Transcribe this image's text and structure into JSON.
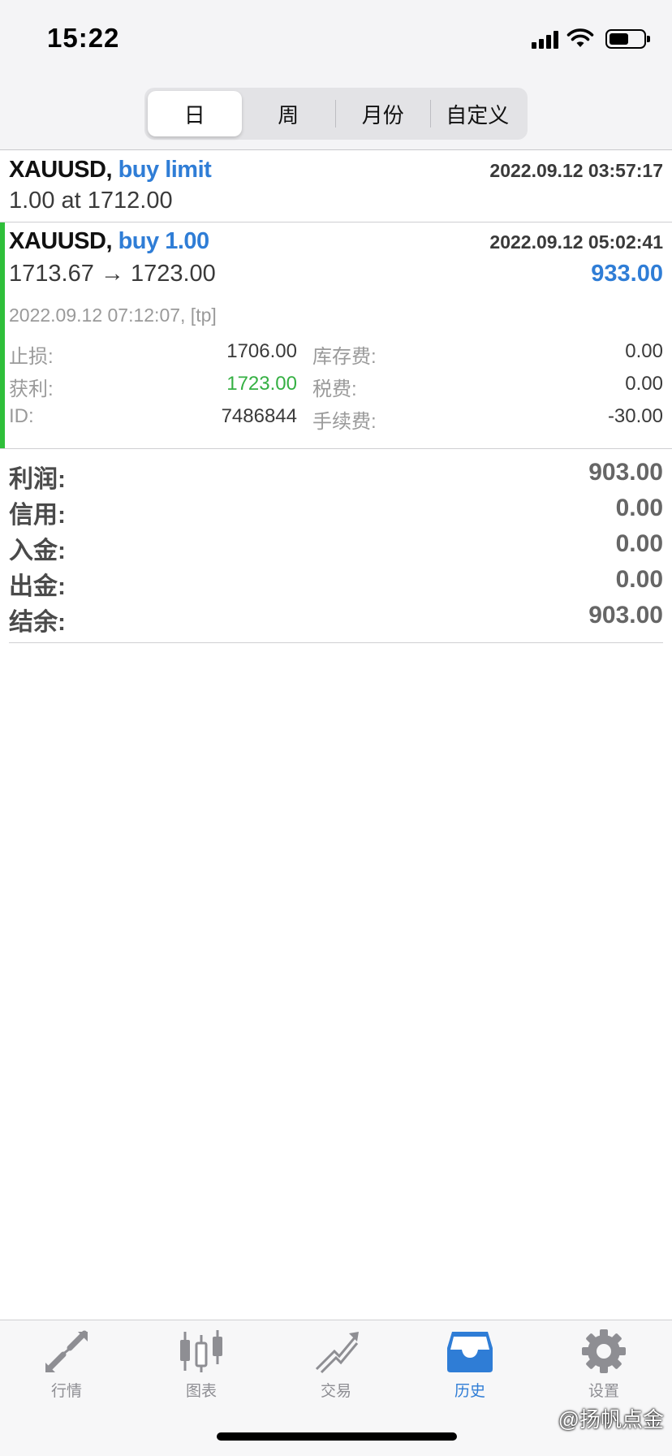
{
  "status_bar": {
    "time": "15:22",
    "battery_level": 0.6
  },
  "period_tabs": {
    "items": [
      "日",
      "周",
      "月份",
      "自定义"
    ],
    "active": "日"
  },
  "order": {
    "symbol": "XAUUSD,",
    "action": "buy limit",
    "time": "2022.09.12 03:57:17",
    "price_line": "1.00 at 1712.00"
  },
  "deal": {
    "symbol": "XAUUSD,",
    "action": "buy 1.00",
    "time": "2022.09.12 05:02:41",
    "price_line": "1713.67 → 1723.00",
    "profit": "933.00",
    "close_info": "2022.09.12 07:12:07, [tp]",
    "details": {
      "sl_label": "止损:",
      "sl_value": "1706.00",
      "swap_label": "库存费:",
      "swap_value": "0.00",
      "tp_label": "获利:",
      "tp_value": "1723.00",
      "tax_label": "税费:",
      "tax_value": "0.00",
      "id_label": "ID:",
      "id_value": "7486844",
      "commission_label": "手续费:",
      "commission_value": "-30.00"
    },
    "accent_color": "#2fbf3a"
  },
  "summary": [
    {
      "label": "利润:",
      "value": "903.00"
    },
    {
      "label": "信用:",
      "value": "0.00"
    },
    {
      "label": "入金:",
      "value": "0.00"
    },
    {
      "label": "出金:",
      "value": "0.00"
    },
    {
      "label": "结余:",
      "value": "903.00"
    }
  ],
  "tabbar": {
    "items": [
      {
        "label": "行情",
        "icon": "quotes-icon"
      },
      {
        "label": "图表",
        "icon": "chart-icon"
      },
      {
        "label": "交易",
        "icon": "trade-icon"
      },
      {
        "label": "历史",
        "icon": "history-icon"
      },
      {
        "label": "设置",
        "icon": "settings-icon"
      }
    ],
    "active": "历史"
  },
  "watermark": "@扬帆点金",
  "colors": {
    "accent_blue": "#2f7dd6",
    "profit_green": "#35b043"
  }
}
